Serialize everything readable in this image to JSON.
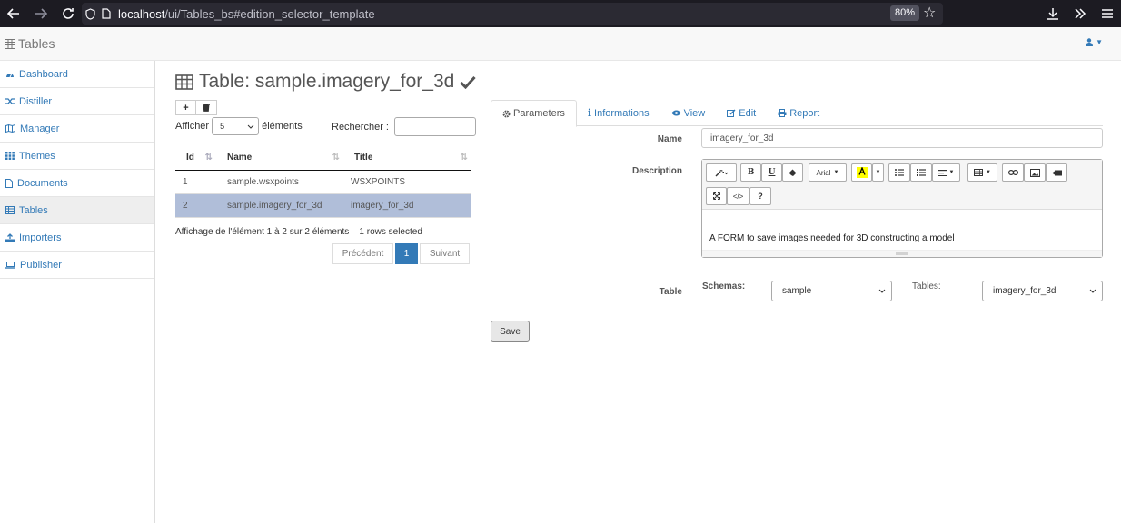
{
  "browser": {
    "url_host": "localhost",
    "url_path": "/ui/Tables_bs#edition_selector_template",
    "zoom": "80%"
  },
  "navbar": {
    "brand": "Tables"
  },
  "sidebar": {
    "items": [
      {
        "label": "Dashboard"
      },
      {
        "label": "Distiller"
      },
      {
        "label": "Manager"
      },
      {
        "label": "Themes"
      },
      {
        "label": "Documents"
      },
      {
        "label": "Tables"
      },
      {
        "label": "Importers"
      },
      {
        "label": "Publisher"
      }
    ]
  },
  "page": {
    "title": "Table: sample.imagery_for_3d"
  },
  "table_panel": {
    "show_label": "Afficher",
    "length_value": "5",
    "elements_label": "éléments",
    "search_label": "Rechercher :",
    "columns": [
      "Id",
      "Name",
      "Title"
    ],
    "rows": [
      {
        "id": "1",
        "name": "sample.wsxpoints",
        "title": "WSXPOINTS"
      },
      {
        "id": "2",
        "name": "sample.imagery_for_3d",
        "title": "imagery_for_3d"
      }
    ],
    "info": "Affichage de l'élément 1 à 2 sur 2 éléments",
    "selected_info": "1 rows selected",
    "pager": {
      "prev": "Précédent",
      "current": "1",
      "next": "Suivant"
    }
  },
  "tabs": [
    {
      "label": "Parameters"
    },
    {
      "label": "Informations"
    },
    {
      "label": "View"
    },
    {
      "label": "Edit"
    },
    {
      "label": "Report"
    }
  ],
  "form": {
    "name_label": "Name",
    "name_value": "imagery_for_3d",
    "description_label": "Description",
    "description_value": "A FORM to save images needed for 3D constructing a model",
    "font_select": "Arial",
    "bold": "B",
    "underline": "U",
    "help": "?",
    "code": "</>",
    "table_label": "Table",
    "schemas_label": "Schemas:",
    "schemas_value": "sample",
    "tables_label": "Tables:",
    "tables_value": "imagery_for_3d",
    "save_label": "Save"
  },
  "colors": {
    "link": "#337ab7",
    "selected_row": "#b0bed9",
    "browser_bg": "#1c1b22"
  }
}
